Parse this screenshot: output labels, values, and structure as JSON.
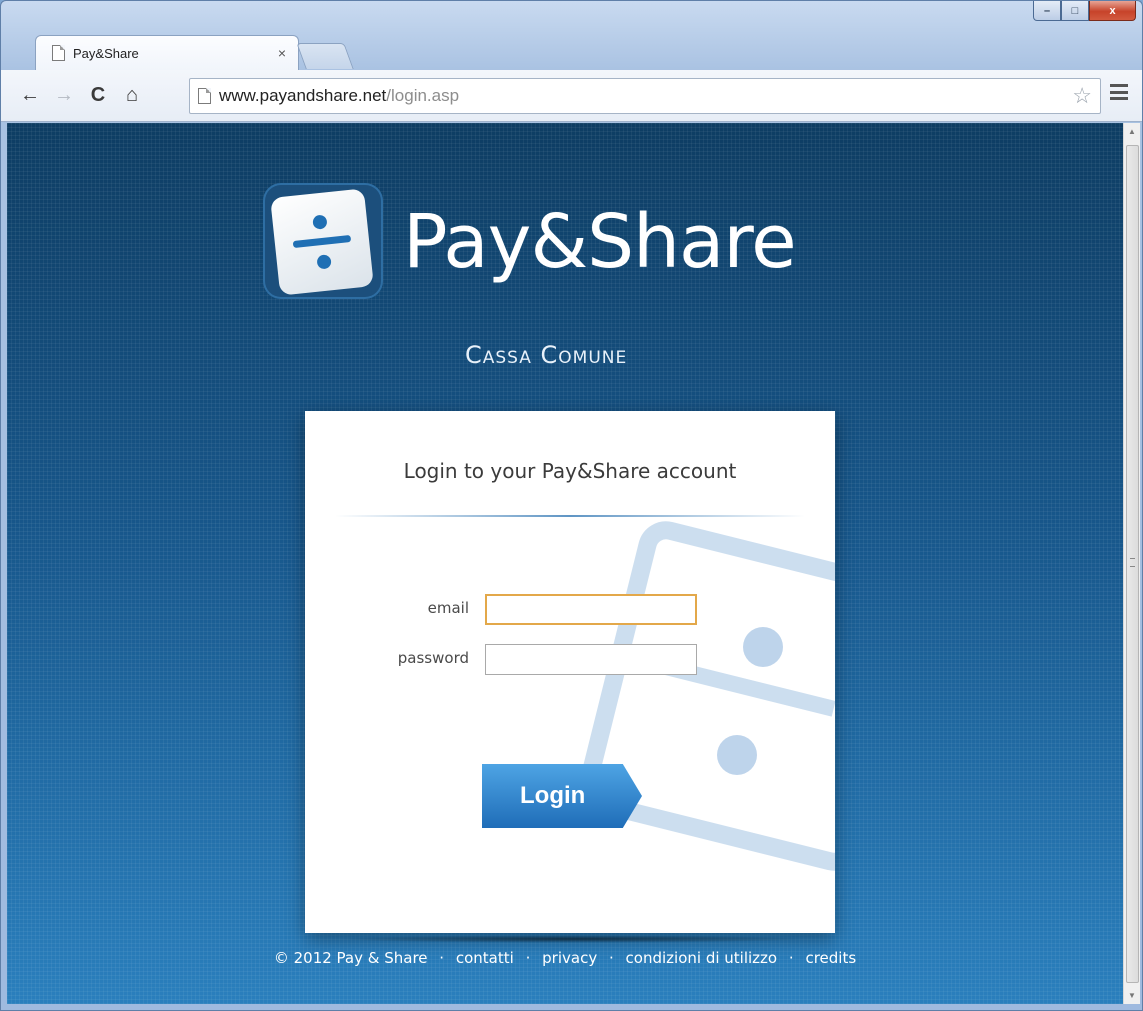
{
  "browser": {
    "tab": {
      "title": "Pay&Share",
      "close": "×"
    },
    "nav": {
      "back": "←",
      "forward": "→",
      "reload": "C",
      "home": "⌂"
    },
    "url": {
      "host": "www.payandshare.net",
      "path": "/login.asp"
    },
    "star": "☆",
    "window_controls": {
      "minimize": "–",
      "maximize": "□",
      "close": "x"
    }
  },
  "page": {
    "brand": "Pay&Share",
    "tagline": "Cassa Comune",
    "login": {
      "title": "Login to your Pay&Share account",
      "email_label": "email",
      "email_value": "",
      "password_label": "password",
      "password_value": "",
      "button_label": "Login"
    },
    "footer": {
      "copyright": "© 2012 Pay & Share",
      "separator": "·",
      "links": [
        "contatti",
        "privacy",
        "condizioni di utilizzo",
        "credits"
      ]
    }
  },
  "colors": {
    "page_bg": "#1f5e8e",
    "accent": "#1f6db8",
    "focus_border": "#e3a84a"
  }
}
